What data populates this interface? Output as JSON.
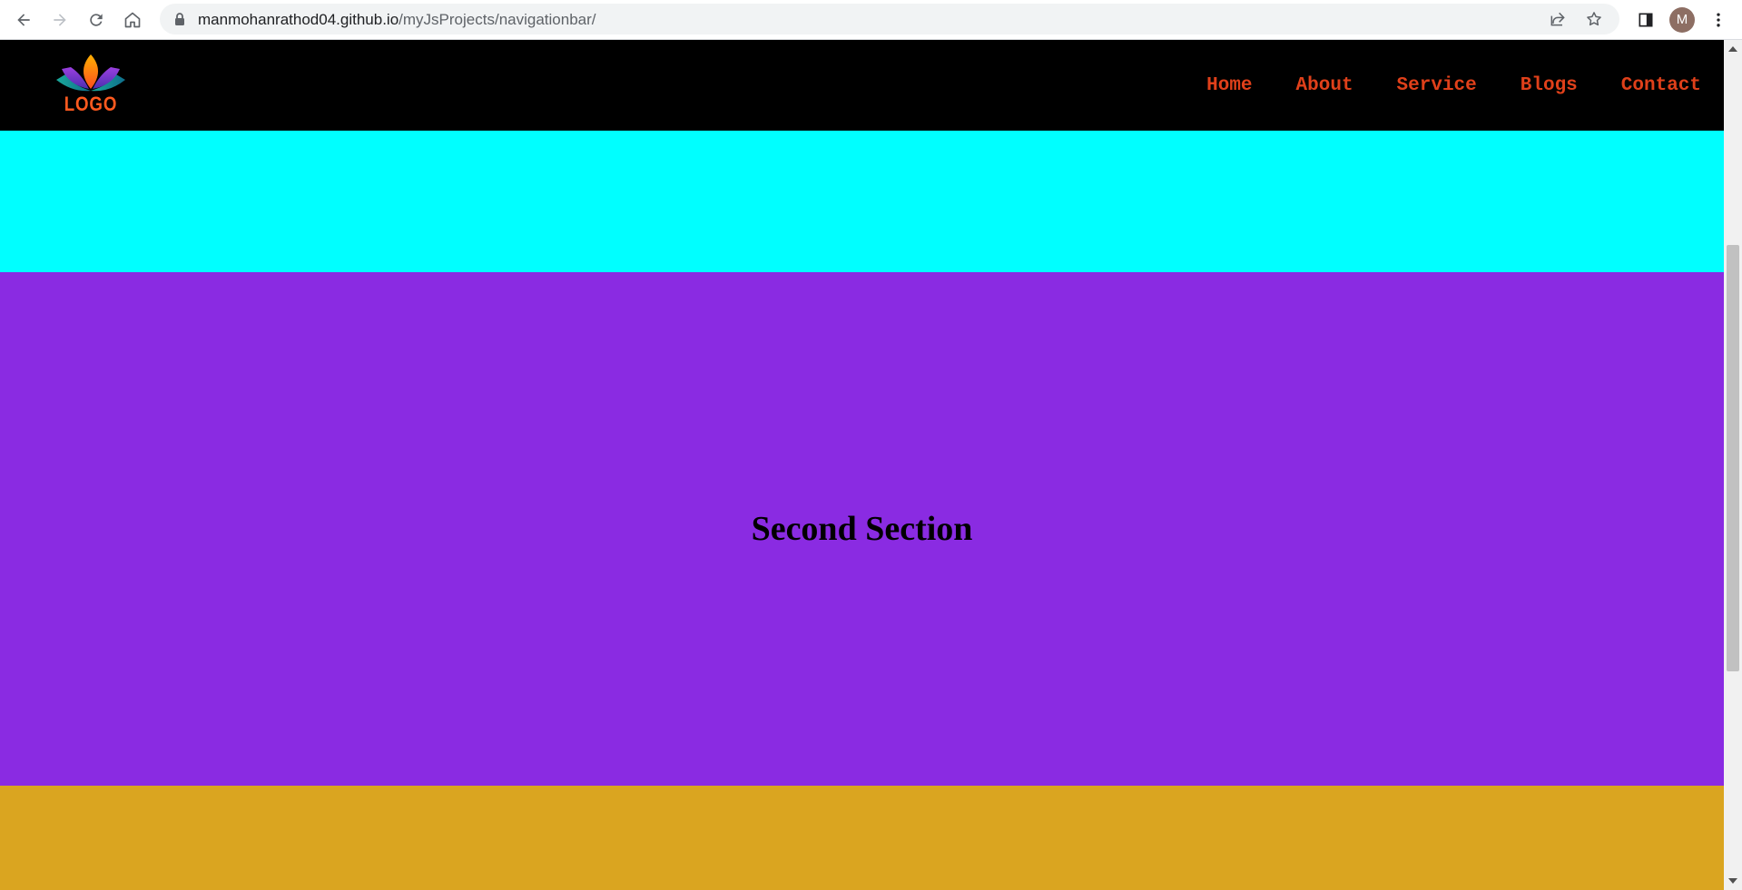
{
  "browser": {
    "url_host": "manmohanrathod04.github.io",
    "url_path": "/myJsProjects/navigationbar/",
    "profile_initial": "M",
    "icons": [
      "back-arrow-icon",
      "forward-arrow-icon",
      "reload-icon",
      "home-icon",
      "lock-icon",
      "share-icon",
      "star-icon",
      "side-panel-icon",
      "more-vert-icon"
    ]
  },
  "header": {
    "logo_text": "LOGO",
    "nav": [
      {
        "label": "Home"
      },
      {
        "label": "About"
      },
      {
        "label": "Service"
      },
      {
        "label": "Blogs"
      },
      {
        "label": "Contact"
      }
    ]
  },
  "sections": {
    "second_title": "Second Section"
  },
  "colors": {
    "header_bg": "#000000",
    "nav_link": "#e0401a",
    "section1": "#00ffff",
    "section2": "#8a2be2",
    "section3": "#daa520"
  }
}
